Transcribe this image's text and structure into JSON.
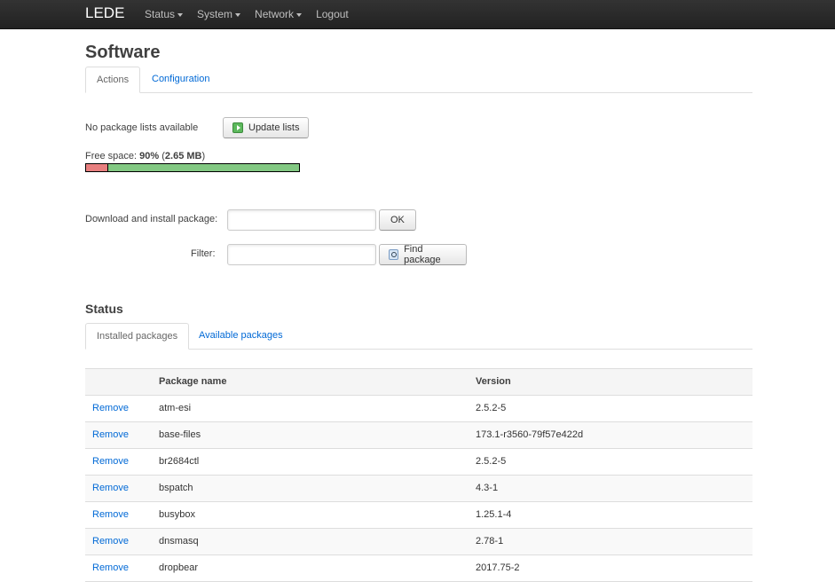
{
  "navbar": {
    "brand": "LEDE",
    "menu": [
      "Status",
      "System",
      "Network"
    ],
    "logout": "Logout"
  },
  "page": {
    "title": "Software"
  },
  "top_tabs": {
    "actions": "Actions",
    "configuration": "Configuration"
  },
  "actions": {
    "no_lists_text": "No package lists available",
    "update_button": "Update lists",
    "free_space_label": "Free space:",
    "free_space_percent": "90%",
    "free_space_size": "2.65 MB",
    "free_space_fraction": 0.9,
    "download_label": "Download and install package:",
    "download_value": "",
    "ok_button": "OK",
    "filter_label": "Filter:",
    "filter_value": "",
    "find_button": "Find package"
  },
  "status": {
    "title": "Status",
    "tabs": {
      "installed": "Installed packages",
      "available": "Available packages"
    },
    "table": {
      "headers": [
        "",
        "Package name",
        "Version"
      ],
      "rows": [
        {
          "action": "Remove",
          "name": "atm-esi",
          "version": "2.5.2-5"
        },
        {
          "action": "Remove",
          "name": "base-files",
          "version": "173.1-r3560-79f57e422d"
        },
        {
          "action": "Remove",
          "name": "br2684ctl",
          "version": "2.5.2-5"
        },
        {
          "action": "Remove",
          "name": "bspatch",
          "version": "4.3-1"
        },
        {
          "action": "Remove",
          "name": "busybox",
          "version": "1.25.1-4"
        },
        {
          "action": "Remove",
          "name": "dnsmasq",
          "version": "2.78-1"
        },
        {
          "action": "Remove",
          "name": "dropbear",
          "version": "2017.75-2"
        }
      ]
    }
  },
  "colors": {
    "navbar": "#222222",
    "link": "#0069d6",
    "used_space": "#e87f7f",
    "free_space": "#82c882"
  }
}
